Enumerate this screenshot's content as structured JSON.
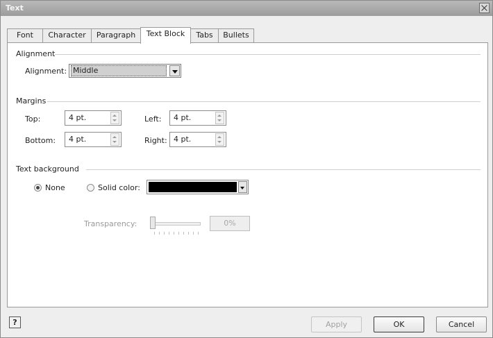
{
  "window": {
    "title": "Text"
  },
  "tabs": [
    {
      "label": "Font"
    },
    {
      "label": "Character"
    },
    {
      "label": "Paragraph"
    },
    {
      "label": "Text Block"
    },
    {
      "label": "Tabs"
    },
    {
      "label": "Bullets"
    }
  ],
  "active_tab": "Text Block",
  "alignment_group": {
    "title": "Alignment",
    "label": "Alignment:",
    "value": "Middle"
  },
  "margins_group": {
    "title": "Margins",
    "top_label": "Top:",
    "top_value": "4 pt.",
    "left_label": "Left:",
    "left_value": "4 pt.",
    "bottom_label": "Bottom:",
    "bottom_value": "4 pt.",
    "right_label": "Right:",
    "right_value": "4 pt."
  },
  "background_group": {
    "title": "Text background",
    "none_label": "None",
    "none_selected": true,
    "solid_label": "Solid color:",
    "solid_color": "#000000",
    "transparency_label": "Transparency:",
    "transparency_value": "0%",
    "transparency_fraction": 0
  },
  "footer": {
    "help": "?",
    "apply": "Apply",
    "ok": "OK",
    "cancel": "Cancel"
  }
}
